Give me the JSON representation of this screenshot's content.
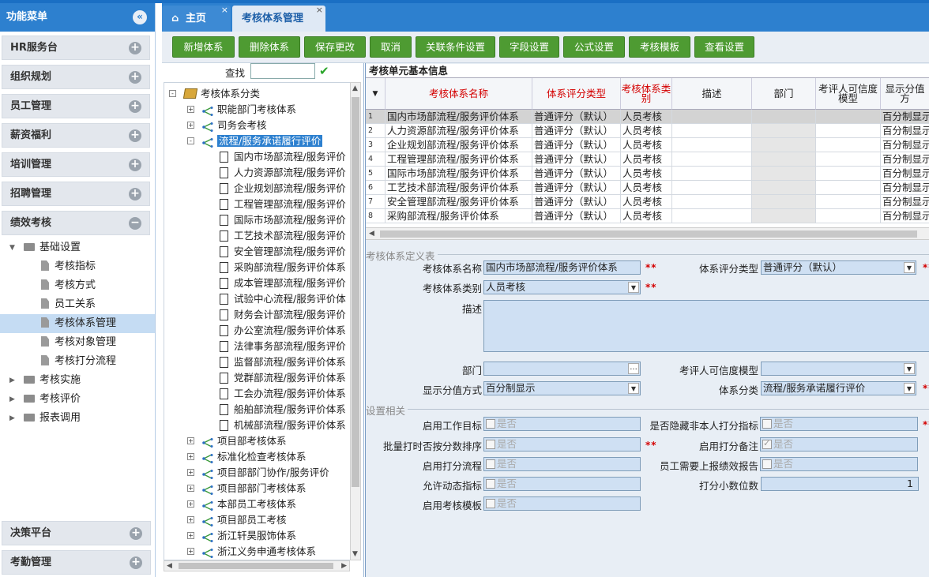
{
  "menu": {
    "title": "功能菜单",
    "sections_top": [
      "HR服务台",
      "组织规划",
      "员工管理",
      "薪资福利",
      "培训管理",
      "招聘管理",
      "绩效考核"
    ],
    "tree": {
      "basic": "基础设置",
      "children": [
        "考核指标",
        "考核方式",
        "员工关系",
        "考核体系管理",
        "考核对象管理",
        "考核打分流程"
      ],
      "others": [
        "考核实施",
        "考核评价",
        "报表调用"
      ]
    },
    "sections_bottom": [
      "决策平台",
      "考勤管理"
    ]
  },
  "tabs": {
    "home": "主页",
    "active": "考核体系管理"
  },
  "toolbar": [
    "新增体系",
    "删除体系",
    "保存更改",
    "取消",
    "关联条件设置",
    "字段设置",
    "公式设置",
    "考核模板",
    "查看设置"
  ],
  "search": {
    "label": "查找",
    "value": ""
  },
  "tree": {
    "root": "考核体系分类",
    "groups_top": [
      "职能部门考核体系",
      "司务会考核"
    ],
    "selected": "流程/服务承诺履行评价",
    "leaves": [
      "国内市场部流程/服务评价",
      "人力资源部流程/服务评价",
      "企业规划部流程/服务评价",
      "工程管理部流程/服务评价",
      "国际市场部流程/服务评价",
      "工艺技术部流程/服务评价",
      "安全管理部流程/服务评价",
      "采购部流程/服务评价体系",
      "成本管理部流程/服务评价",
      "试验中心流程/服务评价体",
      "财务会计部流程/服务评价",
      "办公室流程/服务评价体系",
      "法律事务部流程/服务评价",
      "监督部流程/服务评价体系",
      "党群部流程/服务评价体系",
      "工会办流程/服务评价体系",
      "船舶部流程/服务评价体系",
      "机械部流程/服务评价体系"
    ],
    "groups_bottom": [
      "项目部考核体系",
      "标准化检查考核体系",
      "项目部部门协作/服务评价",
      "项目部部门考核体系",
      "本部员工考核体系",
      "项目部员工考核",
      "浙江轩昊服饰体系",
      "浙江义务申通考核体系"
    ]
  },
  "grid": {
    "title": "考核单元基本信息",
    "headers": [
      "考核体系名称",
      "体系评分类型",
      "考核体系类别",
      "描述",
      "部门",
      "考评人可信度模型",
      "显示分值方"
    ],
    "rows": [
      [
        "1",
        "国内市场部流程/服务评价体系",
        "普通评分（默认）",
        "人员考核",
        "",
        "",
        "",
        "百分制显示"
      ],
      [
        "2",
        "人力资源部流程/服务评价体系",
        "普通评分（默认）",
        "人员考核",
        "",
        "",
        "",
        "百分制显示"
      ],
      [
        "3",
        "企业规划部流程/服务评价体系",
        "普通评分（默认）",
        "人员考核",
        "",
        "",
        "",
        "百分制显示"
      ],
      [
        "4",
        "工程管理部流程/服务评价体系",
        "普通评分（默认）",
        "人员考核",
        "",
        "",
        "",
        "百分制显示"
      ],
      [
        "5",
        "国际市场部流程/服务评价体系",
        "普通评分（默认）",
        "人员考核",
        "",
        "",
        "",
        "百分制显示"
      ],
      [
        "6",
        "工艺技术部流程/服务评价体系",
        "普通评分（默认）",
        "人员考核",
        "",
        "",
        "",
        "百分制显示"
      ],
      [
        "7",
        "安全管理部流程/服务评价体系",
        "普通评分（默认）",
        "人员考核",
        "",
        "",
        "",
        "百分制显示"
      ],
      [
        "8",
        "采购部流程/服务评价体系",
        "普通评分（默认）",
        "人员考核",
        "",
        "",
        "",
        "百分制显示"
      ]
    ]
  },
  "define": {
    "legend": "考核体系定义表",
    "name_label": "考核体系名称",
    "name_value": "国内市场部流程/服务评价体系",
    "score_type_label": "体系评分类型",
    "score_type_value": "普通评分（默认）",
    "category_label": "考核体系类别",
    "category_value": "人员考核",
    "desc_label": "描述",
    "desc_value": "",
    "dept_label": "部门",
    "dept_value": "",
    "cred_label": "考评人可信度模型",
    "cred_value": "",
    "display_label": "显示分值方式",
    "display_value": "百分制显示",
    "class_label": "体系分类",
    "class_value": "流程/服务承诺履行评价",
    "required_mark": "**",
    "ellipsis": "..."
  },
  "settings": {
    "legend": "设置相关",
    "items": [
      {
        "label": "启用工作目标",
        "text": "是否",
        "checked": false
      },
      {
        "label": "是否隐藏非本人打分指标",
        "text": "是否",
        "checked": false
      },
      {
        "label": "批量打时否按分数排序",
        "text": "是否",
        "checked": false
      },
      {
        "label": "启用打分备注",
        "text": "是否",
        "checked": true
      },
      {
        "label": "启用打分流程",
        "text": "是否",
        "checked": false
      },
      {
        "label": "员工需要上报绩效报告",
        "text": "是否",
        "checked": false
      },
      {
        "label": "允许动态指标",
        "text": "是否",
        "checked": false
      },
      {
        "label": "启用考核模板",
        "text": "是否",
        "checked": false
      }
    ],
    "decimal_label": "打分小数位数",
    "decimal_value": "1"
  },
  "colors": {
    "accent": "#2d80cf",
    "button": "#4e9b32",
    "required": "#d40000"
  }
}
